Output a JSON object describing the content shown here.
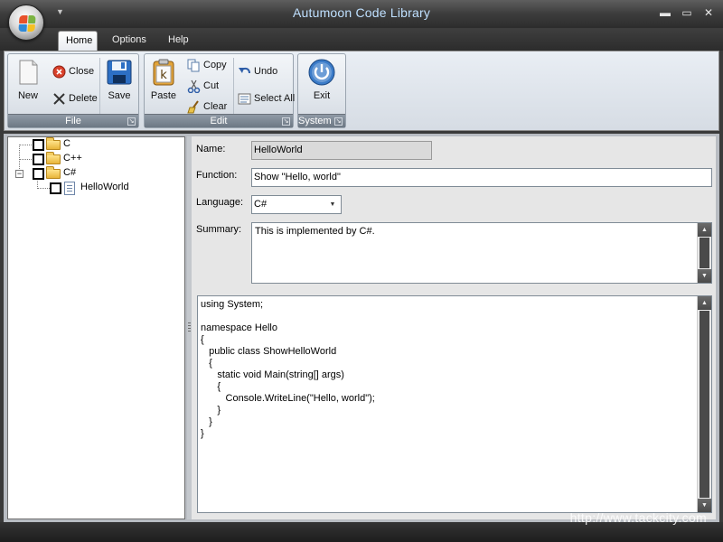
{
  "window": {
    "title": "Autumoon Code Library"
  },
  "menu": {
    "tabs": [
      {
        "label": "Home"
      },
      {
        "label": "Options"
      },
      {
        "label": "Help"
      }
    ]
  },
  "ribbon": {
    "groups": {
      "file": {
        "caption": "File",
        "new": "New",
        "close": "Close",
        "delete": "Delete",
        "save": "Save"
      },
      "edit": {
        "caption": "Edit",
        "paste": "Paste",
        "copy": "Copy",
        "cut": "Cut",
        "clear": "Clear",
        "undo": "Undo",
        "select_all": "Select All"
      },
      "system": {
        "caption": "System",
        "exit": "Exit"
      }
    }
  },
  "tree": {
    "nodes": [
      {
        "label": "C",
        "icon": "folder-icon",
        "checked": false
      },
      {
        "label": "C++",
        "icon": "folder-icon",
        "checked": false
      },
      {
        "label": "C#",
        "icon": "folder-icon",
        "checked": false,
        "expanded": true
      },
      {
        "label": "HelloWorld",
        "icon": "document-icon",
        "checked": false,
        "parent": "C#"
      }
    ]
  },
  "form": {
    "name_label": "Name:",
    "name_value": "HelloWorld",
    "function_label": "Function:",
    "function_value": "Show \"Hello, world\"",
    "language_label": "Language:",
    "language_value": "C#",
    "summary_label": "Summary:",
    "summary_value": "This is implemented by C#.",
    "code_value": "using System;\n\nnamespace Hello\n{\n   public class ShowHelloWorld\n   {\n      static void Main(string[] args)\n      {\n         Console.WriteLine(\"Hello, world\");\n      }\n   }\n}"
  },
  "watermark": "http://www.tackcity.com",
  "colors": {
    "title_text": "#bfe0ff",
    "group_caption": "#6d7884",
    "window_frame": "#2c2c2c"
  }
}
